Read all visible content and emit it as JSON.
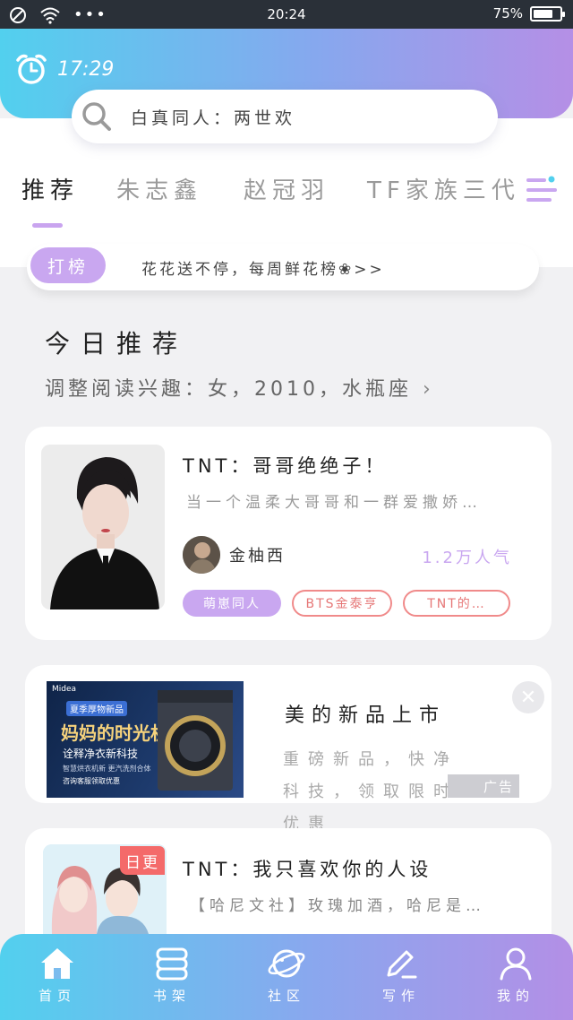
{
  "status_bar": {
    "time": "20:24",
    "battery": "75%",
    "battery_level": 0.75
  },
  "header": {
    "clock_time": "17:29"
  },
  "search": {
    "placeholder": "白真同人：两世欢"
  },
  "tabs": [
    {
      "label": "推荐",
      "active": true
    },
    {
      "label": "朱志鑫",
      "active": false
    },
    {
      "label": "赵冠羽",
      "active": false
    },
    {
      "label": "TF家族三代",
      "active": false
    }
  ],
  "rank_bar": {
    "button": "打榜",
    "text": "花花送不停，每周鲜花榜❀>>"
  },
  "today": {
    "title": "今日推荐",
    "subtitle": "调整阅读兴趣：女，2010，水瓶座"
  },
  "cards": [
    {
      "title": "TNT：哥哥绝绝子！",
      "desc": "当一个温柔大哥哥和一群爱撒娇…",
      "author": "金柚西",
      "heat": "1.2万人气",
      "tags": [
        "萌崽同人",
        "BTS金泰亨",
        "TNT的…"
      ]
    },
    {
      "title": "TNT：我只喜欢你的人设",
      "desc": "【哈尼文社】玫瑰加酒，哈尼是…",
      "badge": "日更"
    }
  ],
  "ad": {
    "title": "美的新品上市",
    "desc": "重磅新品，快净科技，领取限时优惠",
    "label": "广告",
    "close": "✕",
    "image_text": {
      "brand": "Midea",
      "line1": "夏季厚物新品",
      "line2": "妈妈的时光机",
      "line3": "诠释净衣新科技",
      "line4": "智慧烘衣机新  更汽洗剂合体",
      "line5": "咨询客服领取优惠"
    }
  },
  "bottom_nav": [
    {
      "label": "首页",
      "icon": "home-icon"
    },
    {
      "label": "书架",
      "icon": "bookshelf-icon"
    },
    {
      "label": "社区",
      "icon": "planet-icon"
    },
    {
      "label": "写作",
      "icon": "pen-icon"
    },
    {
      "label": "我的",
      "icon": "user-icon"
    }
  ],
  "colors": {
    "gradient_start": "#52d0ee",
    "gradient_end": "#b58fe6",
    "accent_purple": "#c9a7f0",
    "tag_red": "#f08a8a"
  }
}
